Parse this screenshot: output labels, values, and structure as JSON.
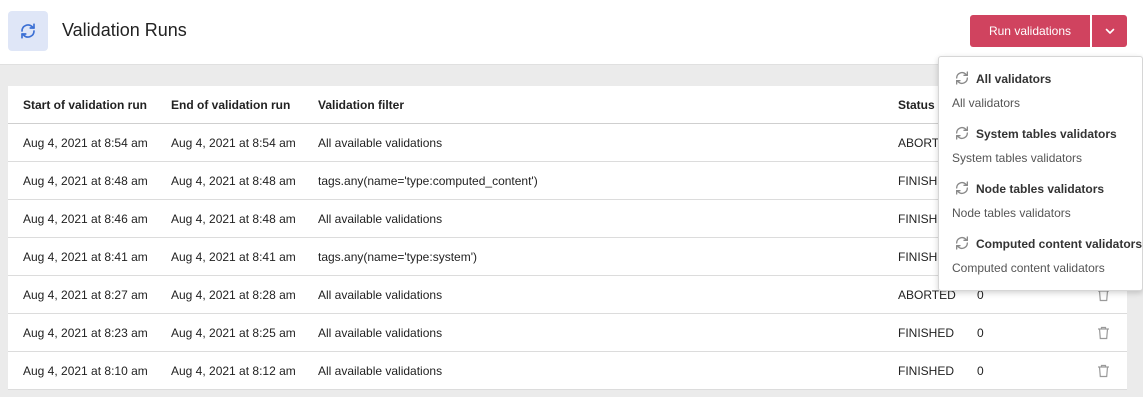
{
  "header": {
    "icon": "refresh-icon",
    "title": "Validation Runs",
    "run_button_label": "Run validations",
    "dropdown_icon": "chevron-down-icon",
    "accent_color": "#d0435f"
  },
  "table": {
    "columns": [
      "Start of validation run",
      "End of validation run",
      "Validation filter",
      "Status",
      "",
      ""
    ],
    "rows": [
      {
        "start": "Aug 4, 2021 at 8:54 am",
        "end": "Aug 4, 2021 at 8:54 am",
        "filter": "All available validations",
        "status": "ABORTED",
        "count": ""
      },
      {
        "start": "Aug 4, 2021 at 8:48 am",
        "end": "Aug 4, 2021 at 8:48 am",
        "filter": "tags.any(name='type:computed_content')",
        "status": "FINISHED",
        "count": ""
      },
      {
        "start": "Aug 4, 2021 at 8:46 am",
        "end": "Aug 4, 2021 at 8:48 am",
        "filter": "All available validations",
        "status": "FINISHED",
        "count": ""
      },
      {
        "start": "Aug 4, 2021 at 8:41 am",
        "end": "Aug 4, 2021 at 8:41 am",
        "filter": "tags.any(name='type:system')",
        "status": "FINISHED",
        "count": ""
      },
      {
        "start": "Aug 4, 2021 at 8:27 am",
        "end": "Aug 4, 2021 at 8:28 am",
        "filter": "All available validations",
        "status": "ABORTED",
        "count": "0"
      },
      {
        "start": "Aug 4, 2021 at 8:23 am",
        "end": "Aug 4, 2021 at 8:25 am",
        "filter": "All available validations",
        "status": "FINISHED",
        "count": "0"
      },
      {
        "start": "Aug 4, 2021 at 8:10 am",
        "end": "Aug 4, 2021 at 8:12 am",
        "filter": "All available validations",
        "status": "FINISHED",
        "count": "0"
      }
    ]
  },
  "dropdown": {
    "items": [
      {
        "title": "All validators",
        "subtitle": "All validators",
        "icon": "refresh-icon"
      },
      {
        "title": "System tables validators",
        "subtitle": "System tables validators",
        "icon": "refresh-icon"
      },
      {
        "title": "Node tables validators",
        "subtitle": "Node tables validators",
        "icon": "refresh-icon"
      },
      {
        "title": "Computed content validators",
        "subtitle": "Computed content validators",
        "icon": "refresh-icon"
      }
    ]
  }
}
